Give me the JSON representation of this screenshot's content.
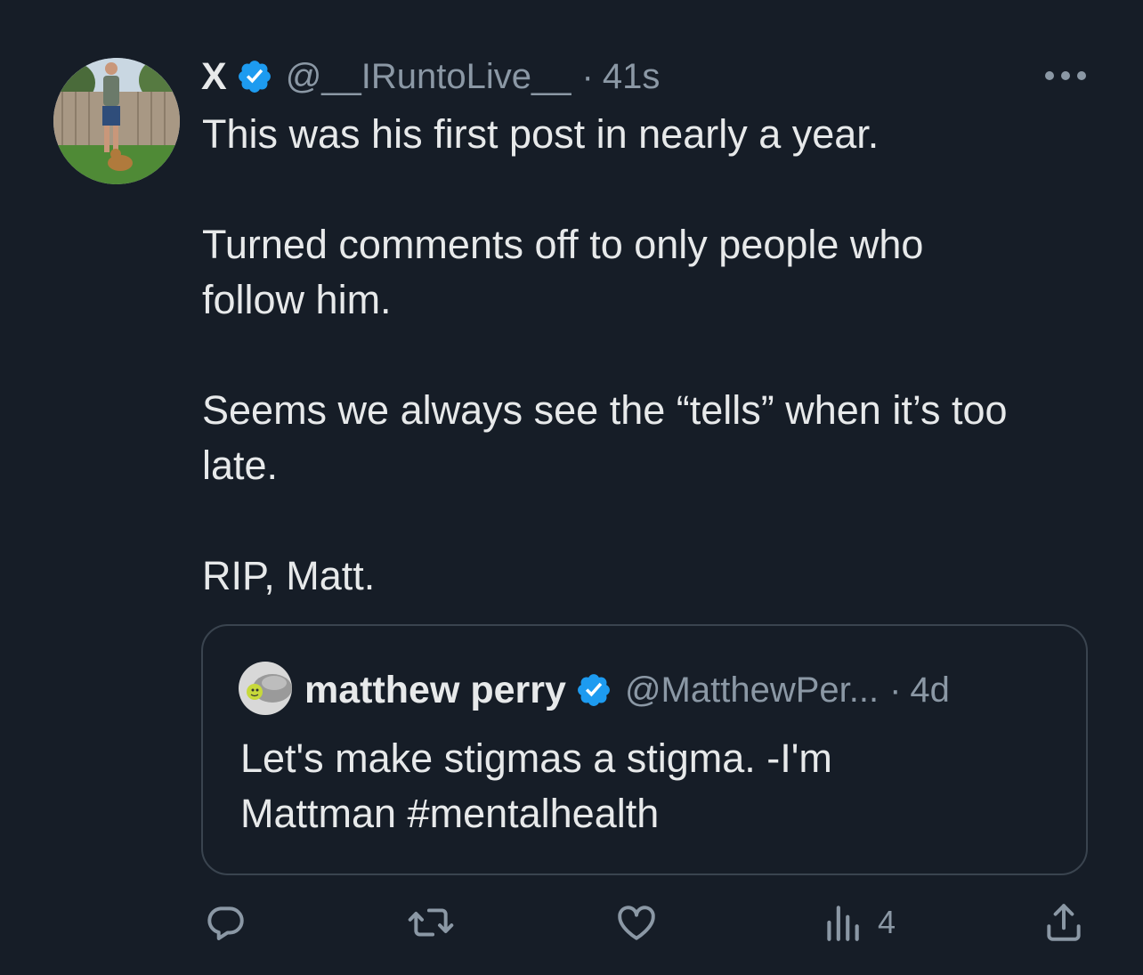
{
  "tweet": {
    "display_name": "X",
    "handle": "@__IRuntoLive__",
    "separator": "·",
    "time": "41s",
    "paragraphs": [
      "This was his first post in nearly a year.",
      "Turned comments off to only people who follow him.",
      "Seems we always see the “tells” when it’s too late.",
      "RIP, Matt."
    ]
  },
  "quote": {
    "display_name": "matthew perry",
    "handle": "@MatthewPer...",
    "separator": "·",
    "time": "4d",
    "text_line1": "Let's make stigmas a stigma. -I'm",
    "text_line2": "Mattman #mentalhealth"
  },
  "actions": {
    "views_count": "4"
  },
  "colors": {
    "background": "#161d27",
    "text": "#e7e9ea",
    "secondary_text": "#8b98a5",
    "verified_badge": "#1d9bf0",
    "border": "#3a444f"
  },
  "icons": [
    "avatar",
    "verified-badge-icon",
    "more-icon",
    "reply-icon",
    "retweet-icon",
    "like-icon",
    "views-icon",
    "share-icon"
  ]
}
